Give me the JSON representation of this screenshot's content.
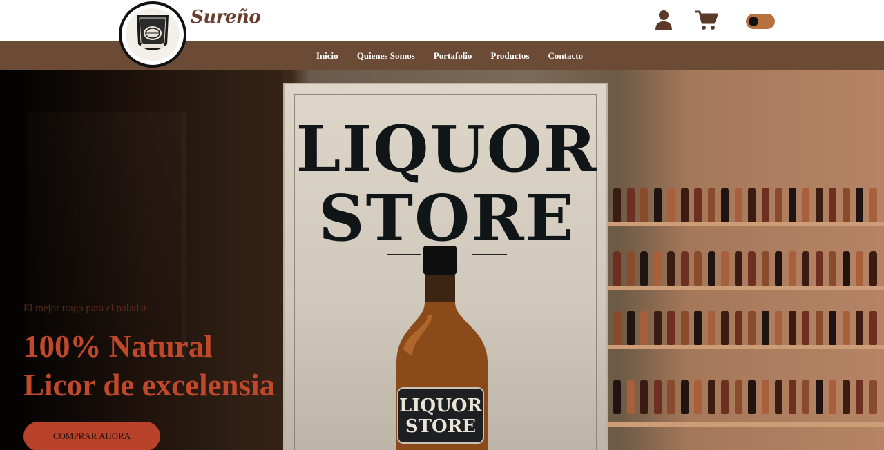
{
  "brand": {
    "name": "Sureño",
    "logo_text": "Sureño"
  },
  "header": {
    "icons": [
      "user-icon",
      "cart-icon"
    ],
    "theme_toggle": {
      "state": "off"
    }
  },
  "nav": {
    "items": [
      {
        "label": "Inicio"
      },
      {
        "label": "Quienes Somos"
      },
      {
        "label": "Portafolio"
      },
      {
        "label": "Productos"
      },
      {
        "label": "Contacto"
      }
    ]
  },
  "hero": {
    "subtitle": "El mejor trago para el paladar",
    "title_line1": "100% Natural",
    "title_line2": "Licor de excelensia",
    "cta_label": "COMPRAR AHORA",
    "poster_line1": "LIQUOR",
    "poster_line2": "STORE",
    "bottle_label_line1": "LIQUOR",
    "bottle_label_line2": "STORE"
  },
  "colors": {
    "nav_bg": "#6b4a36",
    "brand": "#6a3e2c",
    "accent": "#b9422a",
    "toggle": "#b8703f"
  }
}
